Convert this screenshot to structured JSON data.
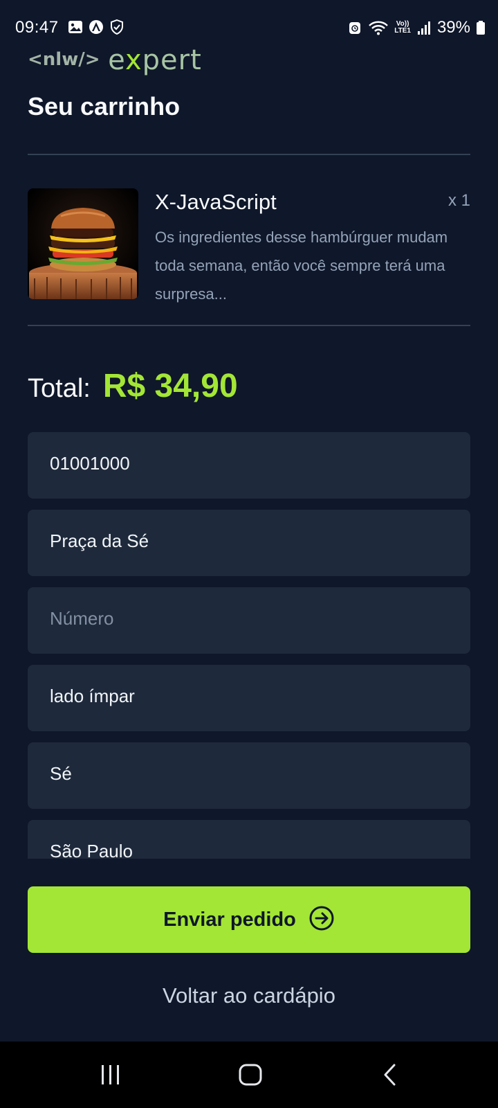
{
  "status_bar": {
    "time": "09:47",
    "battery": "39%",
    "network": "LTE1",
    "volte": "Vo))"
  },
  "logo": {
    "prefix": "<nlw/>",
    "word_start": "e",
    "word_x": "x",
    "word_end": "pert"
  },
  "page": {
    "title": "Seu carrinho"
  },
  "cart": {
    "items": [
      {
        "name": "X-JavaScript",
        "quantity": "x 1",
        "description": "Os ingredientes desse hambúrguer mudam toda semana, então você sempre terá uma surpresa...",
        "image": "burger-photo"
      }
    ]
  },
  "total": {
    "label": "Total:",
    "value": "R$ 34,90"
  },
  "form": {
    "cep": "01001000",
    "street": "Praça da Sé",
    "number_placeholder": "Número",
    "complement": "lado ímpar",
    "district": "Sé",
    "city": "São Paulo"
  },
  "actions": {
    "submit_label": "Enviar pedido",
    "back_label": "Voltar ao cardápio"
  },
  "colors": {
    "background": "#0f172a",
    "input_bg": "#1e293b",
    "accent": "#a3e635",
    "muted_text": "#94a3b8"
  },
  "icons": {
    "submit": "arrow-right-circle-icon",
    "nav_recents": "recents-icon",
    "nav_home": "home-icon",
    "nav_back": "back-icon"
  }
}
